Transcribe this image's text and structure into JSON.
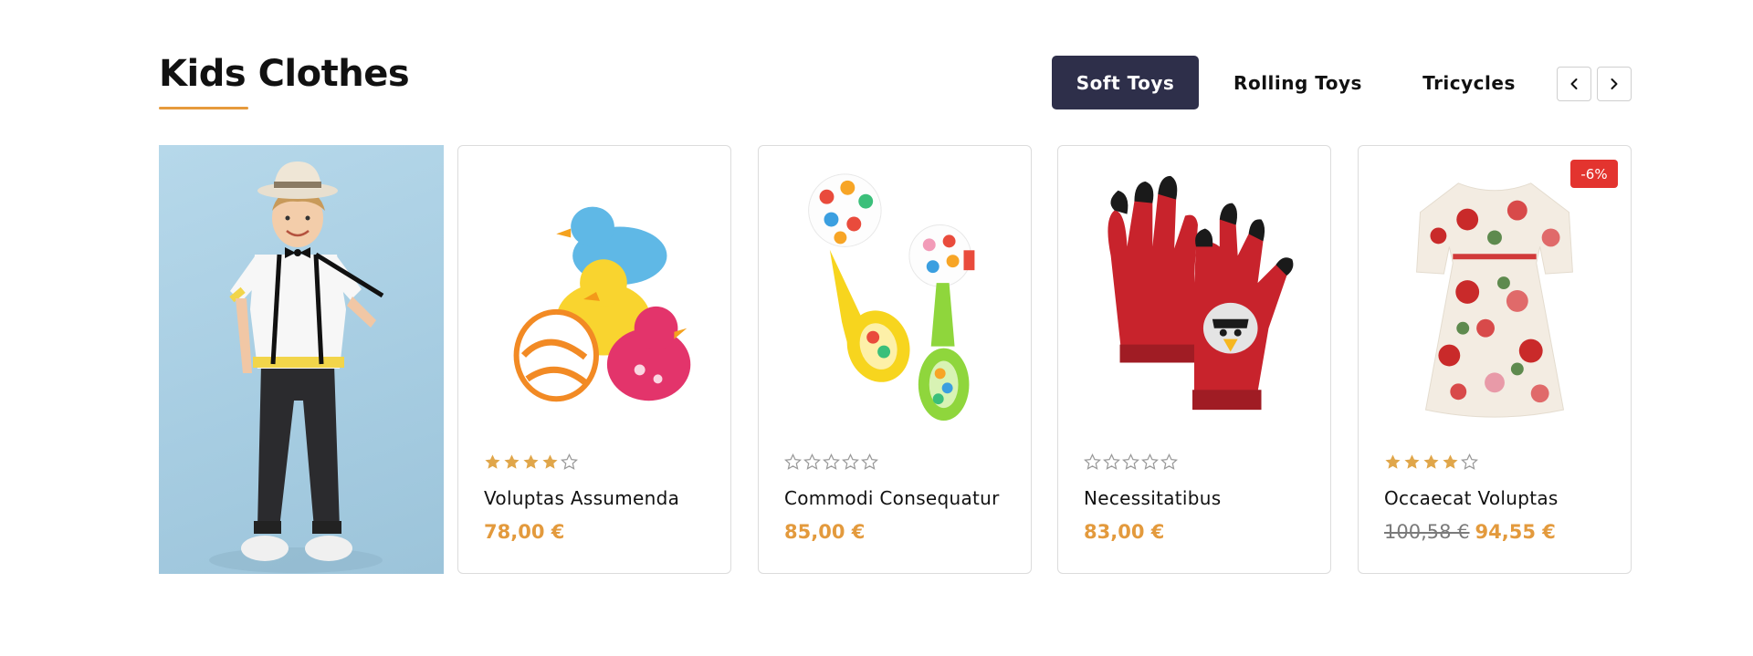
{
  "section": {
    "title": "Kids Clothes"
  },
  "tabs": [
    {
      "label": "Soft Toys",
      "active": true
    },
    {
      "label": "Rolling Toys",
      "active": false
    },
    {
      "label": "Tricycles",
      "active": false
    }
  ],
  "nav": {
    "prev_icon": "chevron-left-icon",
    "next_icon": "chevron-right-icon"
  },
  "colors": {
    "accent": "#e69a3c",
    "tab_active_bg": "#2e2f4a",
    "price": "#e39a3d",
    "badge": "#e3342f",
    "star_filled": "#e0a64a",
    "star_empty": "#9a9a9a"
  },
  "products": [
    {
      "name": "Voluptas Assumenda",
      "price": "78,00 €",
      "old_price": "",
      "rating": 4,
      "badge": ""
    },
    {
      "name": "Commodi Consequatur",
      "price": "85,00 €",
      "old_price": "",
      "rating": 0,
      "badge": ""
    },
    {
      "name": "Necessitatibus",
      "price": "83,00 €",
      "old_price": "",
      "rating": 0,
      "badge": ""
    },
    {
      "name": "Occaecat Voluptas",
      "price": "94,55 €",
      "old_price": "100,58 €",
      "rating": 4,
      "badge": "-6%"
    }
  ]
}
